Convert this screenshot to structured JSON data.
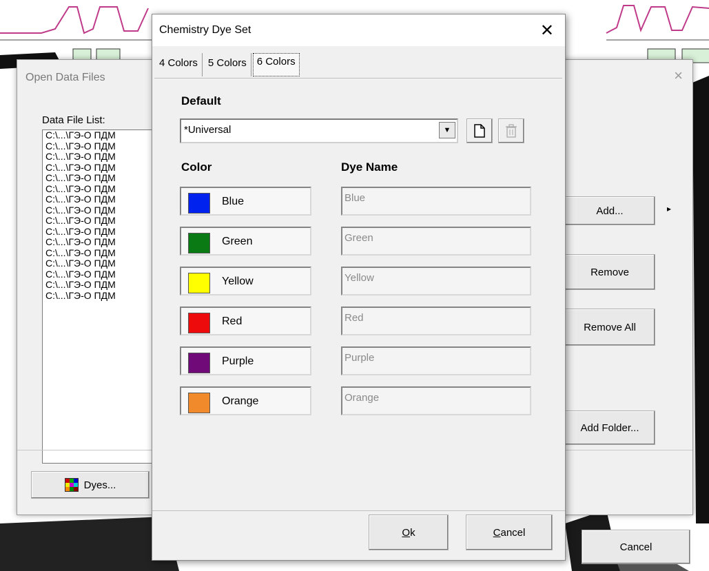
{
  "background_dialog": {
    "title": "Open Data Files",
    "close_glyph": "×",
    "list_label": "Data File List:",
    "files": [
      "C:\\...\\ГЭ-О ПДМ",
      "C:\\...\\ГЭ-О ПДМ",
      "C:\\...\\ГЭ-О ПДМ",
      "C:\\...\\ГЭ-О ПДМ",
      "C:\\...\\ГЭ-О ПДМ",
      "C:\\...\\ГЭ-О ПДМ",
      "C:\\...\\ГЭ-О ПДМ",
      "C:\\...\\ГЭ-О ПДМ",
      "C:\\...\\ГЭ-О ПДМ",
      "C:\\...\\ГЭ-О ПДМ",
      "C:\\...\\ГЭ-О ПДМ",
      "C:\\...\\ГЭ-О ПДМ",
      "C:\\...\\ГЭ-О ПДМ",
      "C:\\...\\ГЭ-О ПДМ",
      "C:\\...\\ГЭ-О ПДМ",
      "C:\\...\\ГЭ-О ПДМ"
    ],
    "buttons": {
      "add": "Add...",
      "add_arrow": "▸",
      "remove": "Remove",
      "remove_all": "Remove All",
      "add_folder": "Add Folder...",
      "dyes": "Dyes...",
      "cancel": "Cancel"
    }
  },
  "dialog": {
    "title": "Chemistry Dye Set",
    "close_glyph": "✕",
    "tabs": [
      "4 Colors",
      "5 Colors",
      "6 Colors"
    ],
    "active_tab": "6 Colors",
    "default_label": "Default",
    "default_value": "*Universal",
    "color_header": "Color",
    "dye_name_header": "Dye Name",
    "dyes": [
      {
        "color": "Blue",
        "hex": "#0022ee",
        "dye_name": "Blue"
      },
      {
        "color": "Green",
        "hex": "#0a7a14",
        "dye_name": "Green"
      },
      {
        "color": "Yellow",
        "hex": "#ffff00",
        "dye_name": "Yellow"
      },
      {
        "color": "Red",
        "hex": "#ee0b0b",
        "dye_name": "Red"
      },
      {
        "color": "Purple",
        "hex": "#6f0a78",
        "dye_name": "Purple"
      },
      {
        "color": "Orange",
        "hex": "#f08a2a",
        "dye_name": "Orange"
      }
    ],
    "ok": {
      "accel": "O",
      "rest": "k"
    },
    "cancel": {
      "accel": "C",
      "rest": "ancel"
    }
  }
}
